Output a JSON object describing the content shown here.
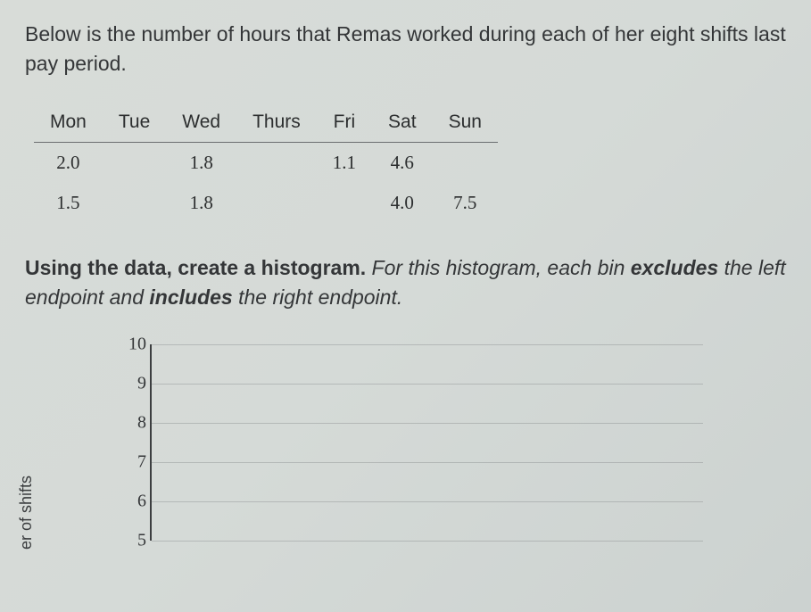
{
  "intro": "Below is the number of hours that Remas worked during each of her eight shifts last pay period.",
  "table": {
    "headers": [
      "Mon",
      "Tue",
      "Wed",
      "Thurs",
      "Fri",
      "Sat",
      "Sun"
    ],
    "rows": [
      [
        "2.0",
        "",
        "1.8",
        "",
        "1.1",
        "4.6",
        ""
      ],
      [
        "1.5",
        "",
        "1.8",
        "",
        "",
        "4.0",
        "7.5"
      ]
    ]
  },
  "instruction": {
    "lead_bold": "Using the data, create a histogram.",
    "ital_1": " For this histogram, each bin ",
    "excl": "excludes",
    "ital_2": " the left endpoint and ",
    "incl": "includes",
    "ital_3": " the right endpoint."
  },
  "chart_data": {
    "type": "bar",
    "ylabel": "er of shifts",
    "yticks": [
      "10",
      "9",
      "8",
      "7",
      "6",
      "5"
    ],
    "ylim": [
      5,
      10
    ]
  }
}
